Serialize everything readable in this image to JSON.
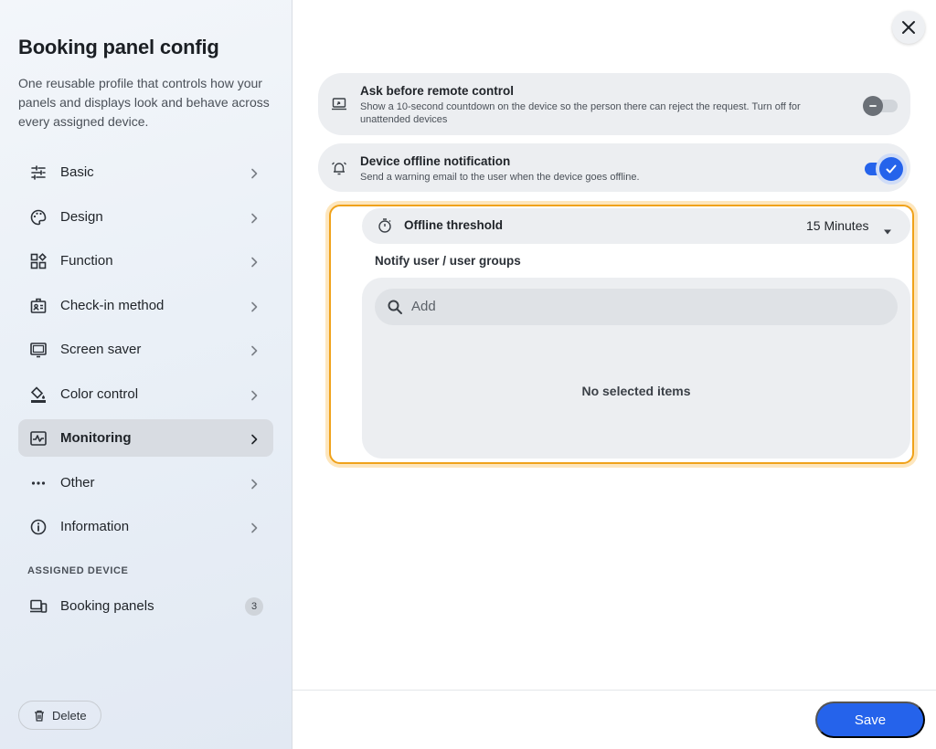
{
  "sidebar": {
    "title": "Booking panel config",
    "description": "One reusable profile that controls how your panels and displays look and behave across every assigned device.",
    "nav": [
      {
        "label": "Basic",
        "icon": "sliders-icon"
      },
      {
        "label": "Design",
        "icon": "palette-icon"
      },
      {
        "label": "Function",
        "icon": "widgets-icon"
      },
      {
        "label": "Check-in method",
        "icon": "badge-icon"
      },
      {
        "label": "Screen saver",
        "icon": "monitor-icon"
      },
      {
        "label": "Color control",
        "icon": "paint-bucket-icon"
      },
      {
        "label": "Monitoring",
        "icon": "monitoring-icon",
        "active": true
      },
      {
        "label": "Other",
        "icon": "more-dots-icon"
      },
      {
        "label": "Information",
        "icon": "info-icon"
      }
    ],
    "assigned_section_label": "ASSIGNED DEVICE",
    "assigned": {
      "label": "Booking panels",
      "count": "3",
      "icon": "devices-icon"
    },
    "delete_label": "Delete"
  },
  "main": {
    "remote_control": {
      "title": "Ask before remote control",
      "description": "Show a 10-second countdown on the device so the person there can reject the request. Turn off for unattended devices",
      "enabled": false
    },
    "offline_notification": {
      "title": "Device offline notification",
      "description": "Send a warning email to the user when the device goes offline.",
      "enabled": true
    },
    "offline_threshold": {
      "label": "Offline threshold",
      "value": "15 Minutes"
    },
    "notify": {
      "label": "Notify user / user groups",
      "search_placeholder": "Add",
      "empty_text": "No selected items"
    }
  },
  "footer": {
    "save_label": "Save"
  },
  "colors": {
    "accent": "#2563eb",
    "highlight_border": "#f0a21a"
  }
}
